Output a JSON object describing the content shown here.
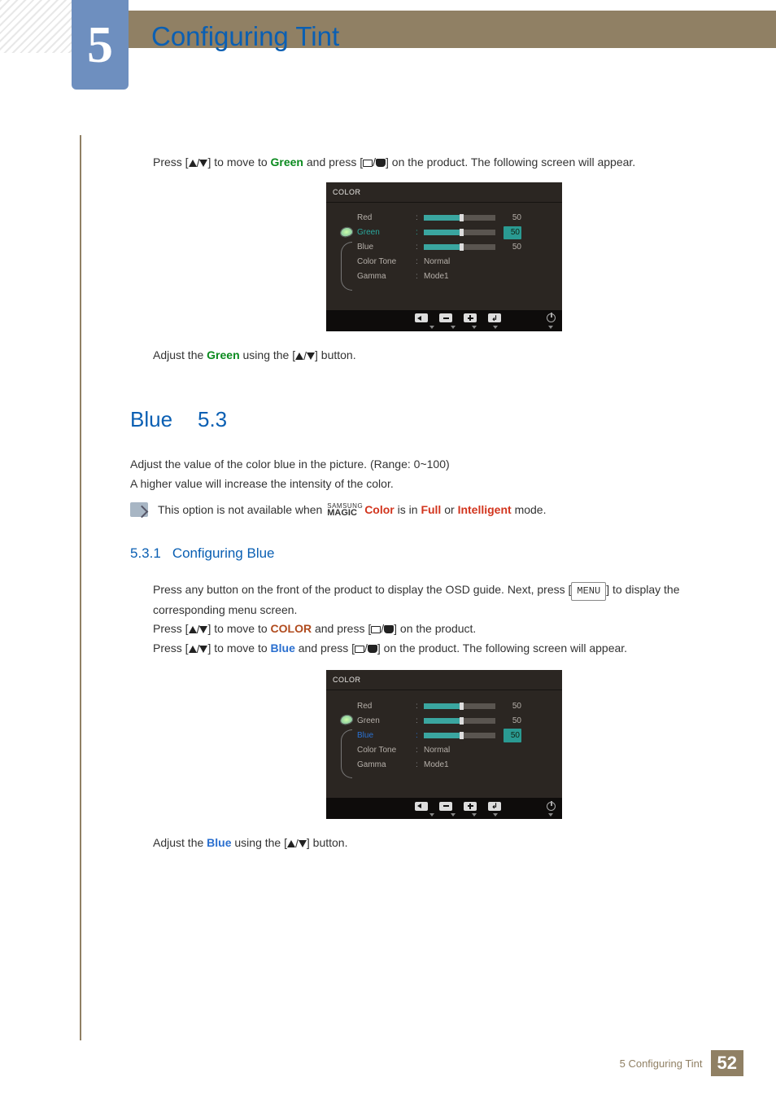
{
  "chapter": {
    "number": "5",
    "title": "Configuring Tint"
  },
  "para1": {
    "pre": "Press [",
    "mid1": "] to move to ",
    "green": "Green",
    "mid2": " and press [",
    "post": "] on the product. The following screen will appear."
  },
  "osd1": {
    "header": "COLOR",
    "rows": {
      "red": {
        "label": "Red",
        "value": "50"
      },
      "green": {
        "label": "Green",
        "value": "50"
      },
      "blue": {
        "label": "Blue",
        "value": "50"
      },
      "colortone": {
        "label": "Color Tone",
        "value": "Normal"
      },
      "gamma": {
        "label": "Gamma",
        "value": "Mode1"
      }
    },
    "highlight": "green"
  },
  "para2": {
    "pre": "Adjust the ",
    "green": "Green",
    "post": " using the [",
    "tail": "] button."
  },
  "section53": {
    "num": "5.3",
    "title": "Blue",
    "p1": "Adjust the value of the color blue in the picture. (Range: 0~100)",
    "p2": "A higher value will increase the intensity of the color.",
    "note_pre": "This option is not available when ",
    "note_color": "Color",
    "note_mid": " is in ",
    "note_full": "Full",
    "note_or": " or ",
    "note_intel": "Intelligent",
    "note_post": " mode.",
    "magic_a": "SAMSUNG",
    "magic_b": "MAGIC"
  },
  "subsec531": {
    "num": "5.3.1",
    "title": "Configuring Blue",
    "p1a": "Press any button on the front of the product to display the OSD guide. Next, press [",
    "menu": "MENU",
    "p1b": "] to display the corresponding menu screen.",
    "p2a": "Press [",
    "p2b": "] to move to ",
    "p2c": "COLOR",
    "p2d": " and press [",
    "p2e": "] on the product.",
    "p3a": "Press [",
    "p3b": "] to move to ",
    "p3c": "Blue",
    "p3d": " and press [",
    "p3e": "] on the product. The following screen will appear."
  },
  "osd2": {
    "header": "COLOR",
    "rows": {
      "red": {
        "label": "Red",
        "value": "50"
      },
      "green": {
        "label": "Green",
        "value": "50"
      },
      "blue": {
        "label": "Blue",
        "value": "50"
      },
      "colortone": {
        "label": "Color Tone",
        "value": "Normal"
      },
      "gamma": {
        "label": "Gamma",
        "value": "Mode1"
      }
    },
    "highlight": "blue"
  },
  "para4": {
    "pre": "Adjust the ",
    "blue": "Blue",
    "post": " using the [",
    "tail": "] button."
  },
  "footer": {
    "label": "5 Configuring Tint",
    "page": "52"
  }
}
